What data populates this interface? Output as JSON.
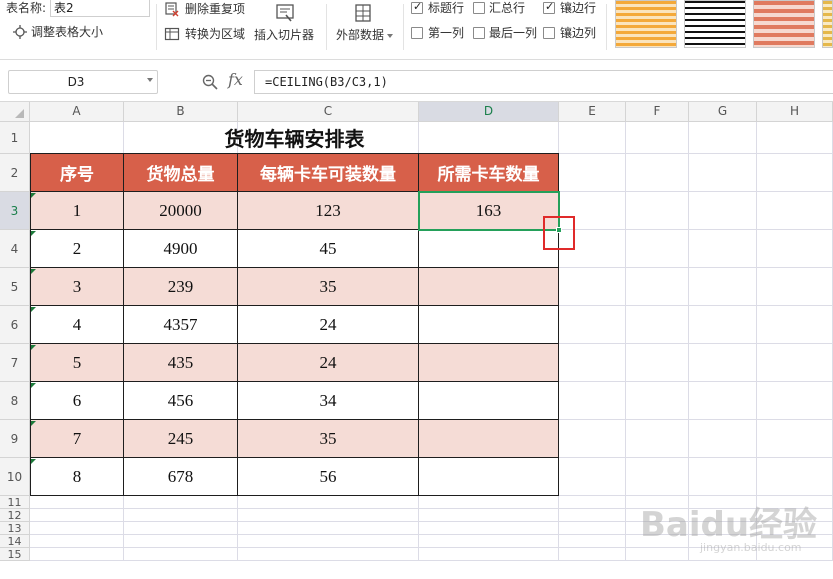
{
  "ribbon": {
    "table_name_label": "表名称:",
    "table_name_value": "表2",
    "resize_table_label": "调整表格大小",
    "remove_duplicates_label": "删除重复项",
    "convert_to_range_label": "转换为区域",
    "insert_slicer_label": "插入切片器",
    "external_data_label": "外部数据",
    "options": {
      "header_row": {
        "label": "标题行",
        "checked": true
      },
      "total_row": {
        "label": "汇总行",
        "checked": false
      },
      "banded_rows": {
        "label": "镶边行",
        "checked": true
      },
      "first_column": {
        "label": "第一列",
        "checked": false
      },
      "last_column": {
        "label": "最后一列",
        "checked": false
      },
      "banded_columns": {
        "label": "镶边列",
        "checked": false
      }
    }
  },
  "formula_bar": {
    "name_box": "D3",
    "fx_label": "fx",
    "formula": "=CEILING(B3/C3,1)"
  },
  "sheet": {
    "columns": [
      "A",
      "B",
      "C",
      "D",
      "E",
      "F",
      "G",
      "H"
    ],
    "rows": [
      "1",
      "2",
      "3",
      "4",
      "5",
      "6",
      "7",
      "8",
      "9",
      "10",
      "11",
      "12",
      "13",
      "14",
      "15"
    ],
    "active_cell": "D3",
    "table": {
      "title": "货物车辆安排表",
      "headers": [
        "序号",
        "货物总量",
        "每辆卡车可装数量",
        "所需卡车数量"
      ],
      "rows": [
        [
          "1",
          "20000",
          "123",
          "163"
        ],
        [
          "2",
          "4900",
          "45",
          ""
        ],
        [
          "3",
          "239",
          "35",
          ""
        ],
        [
          "4",
          "4357",
          "24",
          ""
        ],
        [
          "5",
          "435",
          "24",
          ""
        ],
        [
          "6",
          "456",
          "34",
          ""
        ],
        [
          "7",
          "245",
          "35",
          ""
        ],
        [
          "8",
          "678",
          "56",
          ""
        ]
      ],
      "header_color": "#d7604a",
      "band_color": "#f5dcd6"
    }
  },
  "watermark": {
    "text": "Baidu经验",
    "subtext": "jingyan.baidu.com"
  }
}
